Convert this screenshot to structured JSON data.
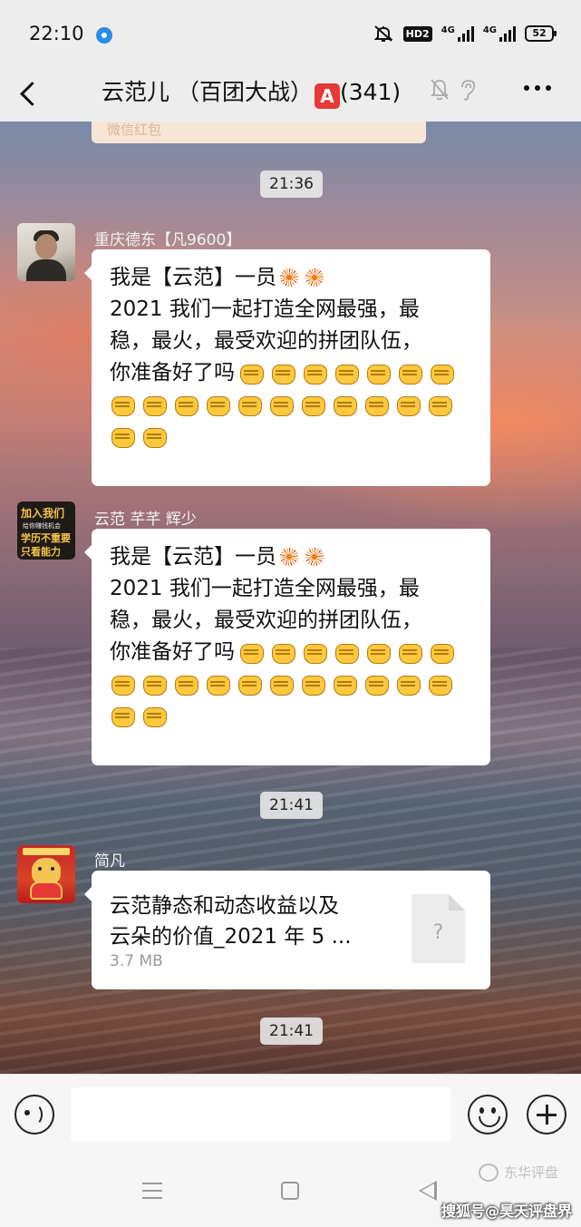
{
  "status_bar": {
    "time": "22:10",
    "network_1": "4G",
    "network_2": "4G",
    "hd_label": "HD2",
    "battery": "52"
  },
  "header": {
    "back_label": "<",
    "title": "云范儿 （百团大战）",
    "badge": "A",
    "member_count": "(341)"
  },
  "messages": {
    "partial_prev": "微信红包",
    "time_1": "21:36",
    "msg1": {
      "sender": "重庆德东【凡9600】",
      "line1": "我是【云范】一员",
      "line2": "2021 我们一起打造全网最强，最",
      "line3": "稳，最火，最受欢迎的拼团队伍，",
      "line4": "你准备好了吗"
    },
    "msg2": {
      "sender": "云范  芊芊  辉少",
      "avatar_text": {
        "t1": "加入我们",
        "t2": "给你赚钱机会",
        "t3": "学历不重要",
        "t4": "只看能力"
      },
      "line1": "我是【云范】一员",
      "line2": "2021 我们一起打造全网最强，最",
      "line3": "稳，最火，最受欢迎的拼团队伍，",
      "line4": "你准备好了吗"
    },
    "time_2": "21:41",
    "msg3": {
      "sender": "简凡",
      "file_line1": "云范静态和动态收益以及",
      "file_line2": "云朵的价值_2021 年 5 ...",
      "file_size": "3.7 MB",
      "file_icon_glyph": "?"
    },
    "time_3": "21:41"
  },
  "input_bar": {
    "placeholder": ""
  },
  "watermark": {
    "line1": "东华评盘",
    "line2": "搜狐号@昊天评盘界"
  },
  "icons": {
    "status": [
      "location-dot-icon",
      "mute-icon",
      "hd-icon",
      "signal-icon",
      "battery-icon"
    ],
    "header": [
      "back-arrow-icon",
      "bell-off-icon",
      "ear-icon",
      "more-dots-icon"
    ],
    "input": [
      "voice-icon",
      "emoji-icon",
      "plus-icon"
    ],
    "emoji": [
      "firework-emoji",
      "fist-emoji"
    ]
  },
  "colors": {
    "bubble": "#ffffff",
    "header_bg": "#ededed",
    "badge": "#e53935",
    "fist": "#ffc83d"
  }
}
